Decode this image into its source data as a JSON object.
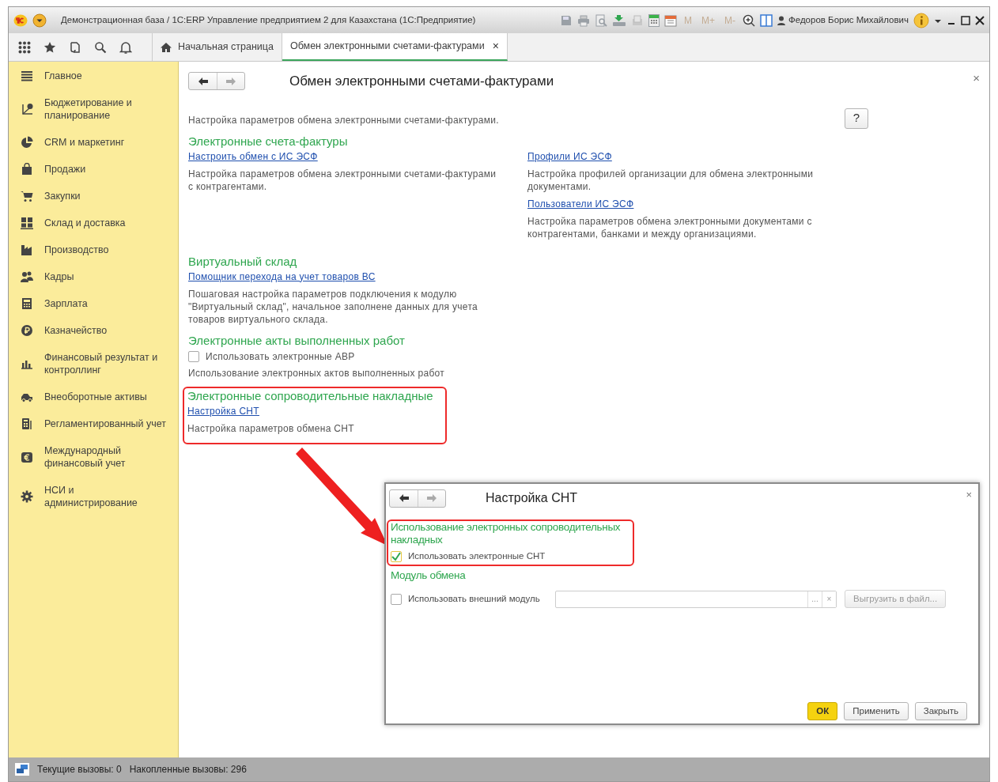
{
  "window": {
    "title": "Демонстрационная база / 1С:ERP Управление предприятием 2 для Казахстана  (1С:Предприятие)",
    "memory_buttons": [
      {
        "label": "M",
        "disabled": true
      },
      {
        "label": "M+",
        "disabled": true
      },
      {
        "label": "M-",
        "disabled": true
      }
    ],
    "user": "Федоров Борис Михайлович"
  },
  "tabs": [
    {
      "label": "Начальная страница",
      "selected": false
    },
    {
      "label": "Обмен электронными счетами-фактурами",
      "selected": true,
      "close": "×"
    }
  ],
  "sidebar": {
    "items": [
      {
        "label": "Главное"
      },
      {
        "label": "Бюджетирование и планирование"
      },
      {
        "label": "CRM и маркетинг"
      },
      {
        "label": "Продажи"
      },
      {
        "label": "Закупки"
      },
      {
        "label": "Склад и доставка"
      },
      {
        "label": "Производство"
      },
      {
        "label": "Кадры"
      },
      {
        "label": "Зарплата"
      },
      {
        "label": "Казначейство"
      },
      {
        "label": "Финансовый результат и контроллинг"
      },
      {
        "label": "Внеоборотные активы"
      },
      {
        "label": "Регламентированный учет"
      },
      {
        "label": "Международный финансовый учет"
      },
      {
        "label": "НСИ и администрирование"
      }
    ]
  },
  "form": {
    "title": "Обмен электронными счетами-фактурами",
    "close": "×",
    "description": "Настройка параметров обмена электронными счетами-фактурами.",
    "help": "?",
    "sections": [
      {
        "title": "Электронные счета-фактуры",
        "highlighted": false,
        "columns": [
          [
            {
              "kind": "link",
              "text": "Настроить обмен с ИС ЭСФ",
              "note": "Настройка параметров обмена электронными счетами-фактурами с контрагентами."
            }
          ],
          [
            {
              "kind": "link",
              "text": "Профили ИС ЭСФ",
              "note": "Настройка профилей организации для обмена электронными документами."
            },
            {
              "kind": "link",
              "text": "Пользователи ИС ЭСФ",
              "note": "Настройка параметров обмена электронными документами с контрагентами, банками и между организациями."
            }
          ]
        ]
      },
      {
        "title": "Виртуальный склад",
        "highlighted": false,
        "columns": [
          [
            {
              "kind": "link",
              "text": "Помощник перехода на учет товаров ВС",
              "note": "Пошаговая настройка параметров подключения к модулю \"Виртуальный склад\", начальное заполнене данных для учета товаров виртуального склада."
            }
          ]
        ]
      },
      {
        "title": "Электронные акты выполненных работ",
        "highlighted": false,
        "columns": [
          [
            {
              "kind": "checkbox",
              "text": "Использовать электронные АВР",
              "checked": false,
              "note": "Использование электронных актов выполненных работ"
            }
          ]
        ]
      },
      {
        "title": "Электронные сопроводительные накладные",
        "highlighted": true,
        "columns": [
          [
            {
              "kind": "link",
              "text": "Настройка СНТ",
              "note": "Настройка параметров обмена СНТ"
            }
          ]
        ]
      }
    ]
  },
  "dialog": {
    "title": "Настройка СНТ",
    "close": "×",
    "groups": [
      {
        "title": "Использование электронных сопроводительных накладных",
        "highlighted": true,
        "checkbox": {
          "label": "Использовать электронные СНТ",
          "checked": true
        }
      },
      {
        "title": "Модуль обмена",
        "highlighted": false,
        "checkbox": {
          "label": "Использовать внешний модуль",
          "checked": false
        },
        "field": {
          "choose": "...",
          "clear": "×"
        },
        "action": {
          "label": "Выгрузить в файл...",
          "disabled": true
        }
      }
    ],
    "buttons": [
      {
        "label": "ОК",
        "default": true
      },
      {
        "label": "Применить",
        "default": false
      },
      {
        "label": "Закрыть",
        "default": false
      }
    ]
  },
  "status_bar": {
    "current_calls": "Текущие вызовы: 0",
    "accumulated_calls": "Накопленные вызовы: 296"
  }
}
